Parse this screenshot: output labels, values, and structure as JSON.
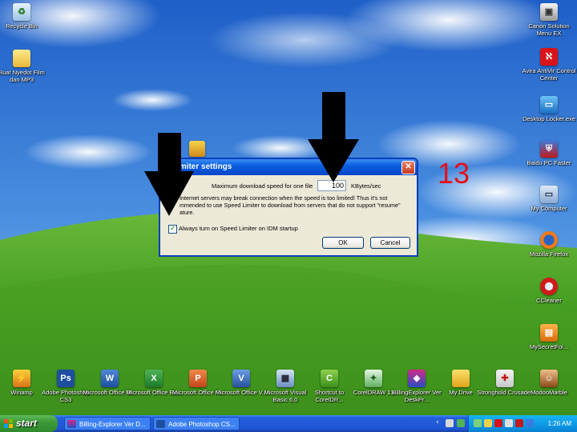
{
  "desktop": {
    "left_icons": [
      {
        "label": "Recycle Bin",
        "icon": "recycle-bin-icon"
      },
      {
        "label": "Buat Nyedot Film dan MP3",
        "icon": "folder-icon"
      }
    ],
    "right_icons": [
      {
        "label": "Canon Solution Menu EX",
        "icon": "canon-icon"
      },
      {
        "label": "Avira AntiVir Control Center",
        "icon": "avira-icon"
      },
      {
        "label": "Desktop Locker.exe",
        "icon": "desktop-locker-icon"
      },
      {
        "label": "Baidu PC Faster",
        "icon": "baidu-shield-icon"
      },
      {
        "label": "My Computer",
        "icon": "my-computer-icon"
      },
      {
        "label": "Mozilla Firefox",
        "icon": "firefox-icon"
      },
      {
        "label": "CCleaner",
        "icon": "ccleaner-icon"
      },
      {
        "label": "MySecretFol...",
        "icon": "mysecretfolder-icon"
      }
    ],
    "bottom_icons": [
      {
        "label": "Winamp",
        "icon": "winamp-icon"
      },
      {
        "label": "Adobe Photoshop CS3",
        "icon": "photoshop-icon"
      },
      {
        "label": "Microsoft Office W...",
        "icon": "word-icon"
      },
      {
        "label": "Microsoft Office Ex...",
        "icon": "excel-icon"
      },
      {
        "label": "Microsoft Office P...",
        "icon": "powerpoint-icon"
      },
      {
        "label": "Microsoft Office V...",
        "icon": "visio-icon"
      },
      {
        "label": "Microsoft Visual Basic 6.0",
        "icon": "visual-basic-icon"
      },
      {
        "label": "Shortcut to CorelDR...",
        "icon": "coreldraw-shortcut-icon"
      },
      {
        "label": "CorelDRAW 11",
        "icon": "coreldraw-icon"
      },
      {
        "label": "BillingExplorer Ver DeskPr...",
        "icon": "billing-explorer-icon"
      },
      {
        "label": "My Drive",
        "icon": "my-drive-icon"
      },
      {
        "label": "Stronghold Crusader",
        "icon": "stronghold-icon"
      },
      {
        "label": "ModooMarble",
        "icon": "modoomarble-icon"
      }
    ]
  },
  "dialog": {
    "title": "d Limiter settings",
    "close_glyph": "✕",
    "max_speed_label": "Maximum download speed for one file",
    "max_speed_value": "100",
    "unit_label": "KBytes/sec",
    "warning_text": "Internet servers may break connection when the speed is too limited! Thus it's not mmended to use Speed Limiter to download from servers that do not support \"resume\" ature.",
    "checkbox_label": "Always turn on Speed Limiter on IDM startup",
    "checkbox_checked": true,
    "ok_label": "OK",
    "cancel_label": "Cancel"
  },
  "annotation": {
    "step_number": "13",
    "arrow_color": "#000000",
    "number_color": "#e5101a"
  },
  "taskbar": {
    "start_label": "start",
    "tasks": [
      {
        "label": "Billing-Explorer Ver D...",
        "icon": "billing-explorer-task-icon"
      },
      {
        "label": "Adobe Photoshop CS...",
        "icon": "photoshop-task-icon"
      }
    ],
    "clock": "1:26 AM"
  },
  "colors": {
    "taskbar_blue": "#245edb",
    "start_green": "#3c9a39",
    "titlebar_blue": "#0a5fe0",
    "dialog_bg": "#ece9d8"
  }
}
